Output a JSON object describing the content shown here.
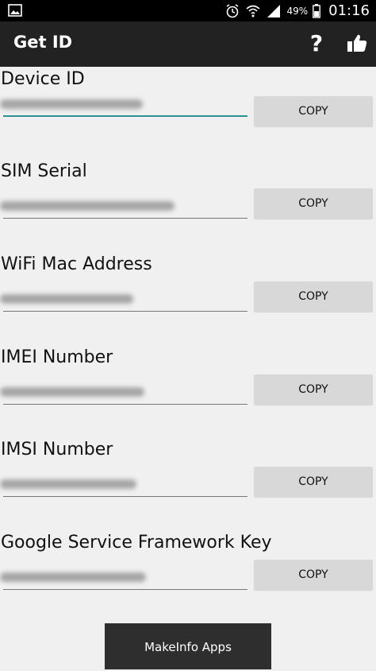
{
  "status_bar": {
    "battery_text": "49%",
    "time": "01:16",
    "icons": [
      "gallery-icon",
      "alarm-icon",
      "wifi-icon",
      "signal-icon",
      "battery-icon"
    ]
  },
  "app_bar": {
    "title": "Get ID",
    "help_label": "?"
  },
  "fields": [
    {
      "label": "Device ID",
      "copy_label": "COPY"
    },
    {
      "label": "SIM Serial",
      "copy_label": "COPY"
    },
    {
      "label": "WiFi Mac Address",
      "copy_label": "COPY"
    },
    {
      "label": "IMEI Number",
      "copy_label": "COPY"
    },
    {
      "label": "IMSI Number",
      "copy_label": "COPY"
    },
    {
      "label": "Google Service Framework Key",
      "copy_label": "COPY"
    }
  ],
  "footer": {
    "label": "MakeInfo Apps"
  },
  "colors": {
    "focus_underline": "#2f8f8f",
    "app_bar": "#222222",
    "background": "#f0f0f0"
  }
}
